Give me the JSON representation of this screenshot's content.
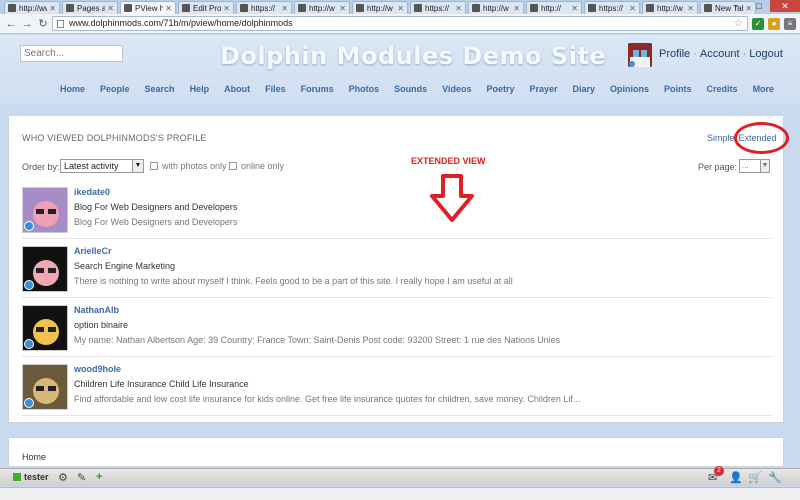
{
  "browser": {
    "tabs": [
      {
        "label": "http://ww",
        "active": false
      },
      {
        "label": "Pages a",
        "active": false
      },
      {
        "label": "PView h",
        "active": true
      },
      {
        "label": "Edit Pro",
        "active": false
      },
      {
        "label": "https://",
        "active": false
      },
      {
        "label": "http://w",
        "active": false
      },
      {
        "label": "http://w",
        "active": false
      },
      {
        "label": "https://",
        "active": false
      },
      {
        "label": "http://w",
        "active": false
      },
      {
        "label": "http://",
        "active": false
      },
      {
        "label": "https://",
        "active": false
      },
      {
        "label": "http://w",
        "active": false
      },
      {
        "label": "New Tab",
        "active": false
      }
    ],
    "url": "www.dolphinmods.com/71b/m/pview/home/dolphinmods"
  },
  "header": {
    "search_placeholder": "Search...",
    "site_title": "Dolphin Modules Demo Site",
    "user_links": {
      "profile": "Profile",
      "account": "Account",
      "logout": "Logout",
      "separator": "·"
    },
    "nav": [
      "Home",
      "People",
      "Search",
      "Help",
      "About",
      "Files",
      "Forums",
      "Photos",
      "Sounds",
      "Videos",
      "Poetry",
      "Prayer",
      "Diary",
      "Opinions",
      "Points",
      "Credits",
      "More"
    ]
  },
  "panel": {
    "title": "WHO VIEWED DOLPHINMODS'S PROFILE",
    "view_simple": "Simple",
    "view_extended": "Extended",
    "order_label": "Order by:",
    "order_value": "Latest activity",
    "filter_photos": "with photos only",
    "filter_online": "online only",
    "perpage_label": "Per page:",
    "perpage_value": "..."
  },
  "annotation": {
    "text": "EXTENDED VIEW",
    "color": "#e02020"
  },
  "members": [
    {
      "name": "ikedate0",
      "headline": "Blog For Web Designers and Developers",
      "desc": "Blog For Web Designers and Developers",
      "avatar_bg": "#a78cc6",
      "avatar_face": "#ef9fb3"
    },
    {
      "name": "ArielleCr",
      "headline": "Search Engine Marketing",
      "desc": "There is nothing to write about myself I think. Feels good to be a part of this site. I really hope I am useful at all",
      "avatar_bg": "#111111",
      "avatar_face": "#f0a9b3"
    },
    {
      "name": "NathanAlb",
      "headline": "option binaire",
      "desc": "My name: Nathan Albertson Age: 39 Country: France Town: Saint-Denis Post code: 93200 Street: 1 rue des Nations Unies",
      "avatar_bg": "#111111",
      "avatar_face": "#f2c14e"
    },
    {
      "name": "wood9hole",
      "headline": "Children Life Insurance Child Life Insurance",
      "desc": "Find affordable and low cost life insurance for kids online. Get free life insurance quotes for children, save money. Children Lif...",
      "avatar_bg": "#6b5a3b",
      "avatar_face": "#d9b67a"
    }
  ],
  "footer": {
    "home": "Home"
  },
  "bottombar": {
    "username": "tester",
    "badge_count": "2"
  }
}
